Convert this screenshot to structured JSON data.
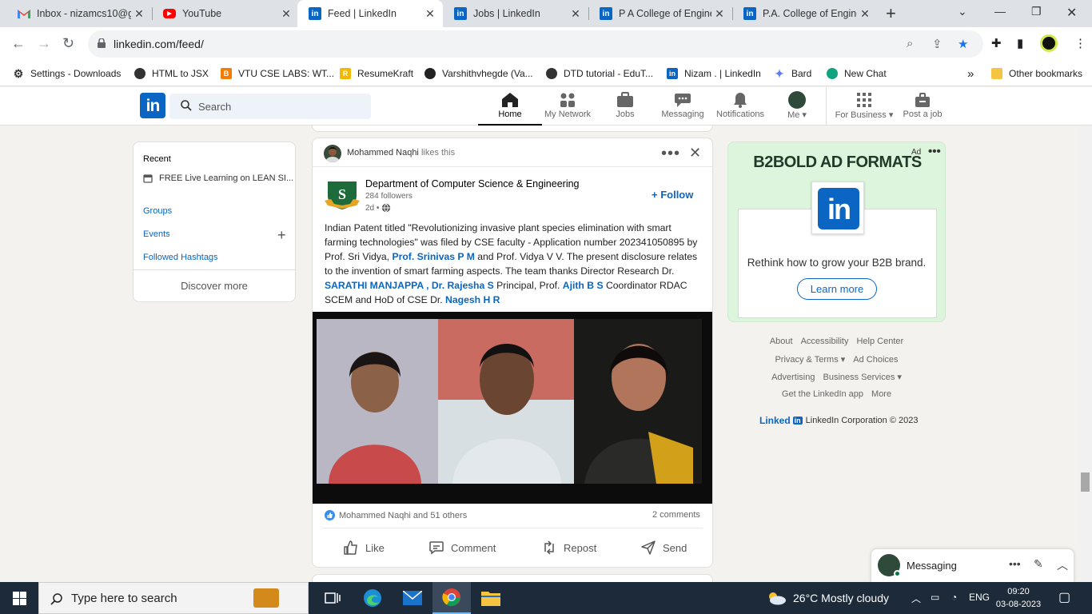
{
  "browser": {
    "tabs": [
      {
        "title": "Inbox - nizamcs10@gi",
        "icon": "gmail-icon"
      },
      {
        "title": "YouTube",
        "icon": "youtube-icon"
      },
      {
        "title": "Feed | LinkedIn",
        "icon": "linkedin-icon",
        "active": true
      },
      {
        "title": "Jobs | LinkedIn",
        "icon": "linkedin-icon"
      },
      {
        "title": "P A College of Enginee",
        "icon": "linkedin-icon"
      },
      {
        "title": "P.A. College of Enginee",
        "icon": "linkedin-icon"
      }
    ],
    "url": "linkedin.com/feed/",
    "bookmarks": [
      {
        "label": "Settings - Downloads",
        "icon": "gear-icon"
      },
      {
        "label": "HTML to JSX",
        "icon": "globe-icon"
      },
      {
        "label": "VTU CSE LABS: WT...",
        "icon": "blogger-icon"
      },
      {
        "label": "ResumeKraft",
        "icon": "resumekraft-icon"
      },
      {
        "label": "Varshithvhegde (Va...",
        "icon": "github-icon"
      },
      {
        "label": "DTD tutorial - EduT...",
        "icon": "globe-icon"
      },
      {
        "label": "Nizam . | LinkedIn",
        "icon": "linkedin-icon"
      },
      {
        "label": "Bard",
        "icon": "bard-icon"
      },
      {
        "label": "New Chat",
        "icon": "chatgpt-icon"
      }
    ],
    "other_bookmarks": "Other bookmarks",
    "overflow": "»"
  },
  "linkedin": {
    "logo": "in",
    "search_placeholder": "Search",
    "nav": [
      {
        "label": "Home",
        "icon": "home-icon",
        "active": true
      },
      {
        "label": "My Network",
        "icon": "network-icon"
      },
      {
        "label": "Jobs",
        "icon": "briefcase-icon"
      },
      {
        "label": "Messaging",
        "icon": "chat-icon"
      },
      {
        "label": "Notifications",
        "icon": "bell-icon"
      },
      {
        "label": "Me ▾",
        "icon": "avatar"
      },
      {
        "label": "For Business ▾",
        "icon": "grid-icon"
      },
      {
        "label": "Post a job",
        "icon": "post-job-icon"
      }
    ]
  },
  "left": {
    "recent_title": "Recent",
    "recent_item": "FREE Live Learning on LEAN SI...",
    "groups": "Groups",
    "events": "Events",
    "hashtags": "Followed Hashtags",
    "discover": "Discover more"
  },
  "post": {
    "liker": "Mohammed Naqhi",
    "liker_suffix": "likes this",
    "org_name": "Department of Computer Science & Engineering",
    "followers": "284 followers",
    "time": "2d •",
    "follow": "+ Follow",
    "text": [
      {
        "t": "Indian Patent titled \"Revolutionizing invasive plant species elimination with smart farming technologies\" was filed by CSE faculty - Application number 202341050895 by Prof. Sri Vidya, "
      },
      {
        "m": "Prof. Srinivas P M"
      },
      {
        "t": " and Prof. Vidya V V. The present disclosure relates to the invention of smart farming aspects. The team thanks Director Research Dr. "
      },
      {
        "m": "SARATHI MANJAPPA ,"
      },
      {
        "t": " "
      },
      {
        "m": "Dr. Rajesha S"
      },
      {
        "t": " Principal, Prof. "
      },
      {
        "m": "Ajith B S"
      },
      {
        "t": " Coordinator RDAC SCEM and HoD of CSE Dr. "
      },
      {
        "m": "Nagesh H R"
      }
    ],
    "reactions": "Mohammed Naqhi and 51 others",
    "comments": "2 comments",
    "actions": {
      "like": "Like",
      "comment": "Comment",
      "repost": "Repost",
      "send": "Send"
    }
  },
  "ad": {
    "badge": "Ad",
    "title": "B2BOLD AD FORMATS",
    "logo": "in",
    "text": "Rethink how to grow your B2B brand.",
    "button": "Learn more"
  },
  "footer": {
    "row1": [
      "About",
      "Accessibility",
      "Help Center"
    ],
    "row2": [
      "Privacy & Terms ▾",
      "Ad Choices"
    ],
    "row3": [
      "Advertising",
      "Business Services ▾"
    ],
    "row4": [
      "Get the LinkedIn app",
      "More"
    ],
    "brand": "Linked",
    "brand_box": "in",
    "copyright": "LinkedIn Corporation © 2023"
  },
  "messaging": {
    "title": "Messaging"
  },
  "taskbar": {
    "search_placeholder": "Type here to search",
    "weather": "26°C  Mostly cloudy",
    "lang": "ENG",
    "time": "09:20",
    "date": "03-08-2023"
  }
}
